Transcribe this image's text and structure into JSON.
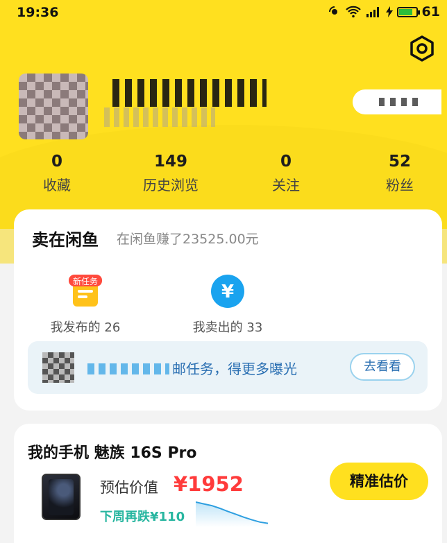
{
  "status_bar": {
    "time": "19:36",
    "battery": "61"
  },
  "stats": [
    {
      "count": "0",
      "label": "收藏"
    },
    {
      "count": "149",
      "label": "历史浏览"
    },
    {
      "count": "0",
      "label": "关注"
    },
    {
      "count": "52",
      "label": "粉丝"
    }
  ],
  "sell_section": {
    "title": "卖在闲鱼",
    "subtitle": "在闲鱼赚了23525.00元",
    "published": {
      "label": "我发布的 26",
      "badge": "新任务",
      "icon": "list-doc-icon"
    },
    "sold": {
      "label": "我卖出的 33",
      "icon": "yen-coin-icon"
    },
    "promo": {
      "text": "邮任务，得更多曝光",
      "button": "去看看"
    }
  },
  "phone_section": {
    "title": "我的手机 魅族 16S Pro",
    "estimate_label": "预估价值",
    "estimate_price": "¥1952",
    "next_week_drop": "下周再跌¥110",
    "button": "精准估价",
    "price_trend": [
      1.0,
      0.92,
      0.84,
      0.72,
      0.58,
      0.45,
      0.32,
      0.2,
      0.1,
      0.04
    ]
  },
  "colors": {
    "brand_yellow": "#ffe01f",
    "price_red": "#ff3b3b",
    "drop_teal": "#28b6a0",
    "promo_blue": "#2a6fb2"
  }
}
